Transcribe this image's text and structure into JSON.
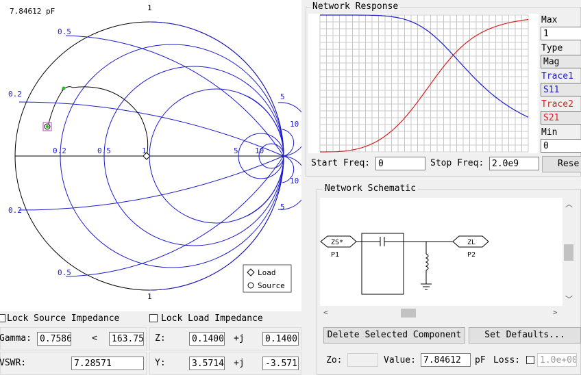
{
  "smith": {
    "capacitance_readout": "7.84612 pF",
    "labels_outer": [
      "1",
      "0.5",
      "0.2",
      "5",
      "10",
      "10",
      "5",
      "0.2",
      "0.5",
      "1"
    ],
    "labels_axis": [
      "0.2",
      "0.5",
      "1",
      "5",
      "10"
    ],
    "legend": {
      "load": "Load",
      "source": "Source"
    }
  },
  "impedance": {
    "lock_source_label": "Lock Source Impedance",
    "lock_load_label": "Lock Load Impedance",
    "gamma_label": "Gamma:",
    "gamma_mag": "0.7586",
    "angle_symbol": "<",
    "gamma_angle": "163.75",
    "z_label": "Z:",
    "z_real": "0.1400",
    "plus_j": "+j",
    "z_imag": "0.1400",
    "vswr_label": "VSWR:",
    "vswr": "7.28571",
    "y_label": "Y:",
    "y_real": "3.5714",
    "y_imag": "-3.571"
  },
  "network_response": {
    "title": "Network Response",
    "max_label": "Max",
    "max_value": "1",
    "type_label": "Type",
    "type_value": "Mag",
    "trace1_label": "Trace1",
    "trace1_value": "S11",
    "trace1_color": "#1a1acc",
    "trace2_label": "Trace2",
    "trace2_value": "S21",
    "trace2_color": "#d42020",
    "min_label": "Min",
    "min_value": "0",
    "start_freq_label": "Start Freq:",
    "start_freq": "0",
    "stop_freq_label": "Stop Freq:",
    "stop_freq": "2.0e9",
    "reset_label": "Rese"
  },
  "schematic": {
    "title": "Network Schematic",
    "source_tag": "ZS*",
    "source_port": "P1",
    "load_tag": "ZL",
    "load_port": "P2",
    "delete_label": "Delete Selected Component",
    "defaults_label": "Set Defaults...",
    "zo_label": "Zo:",
    "value_label": "Value:",
    "value": "7.84612",
    "unit": "pF",
    "loss_label": "Loss:",
    "loss_value": "1.0e+00"
  }
}
